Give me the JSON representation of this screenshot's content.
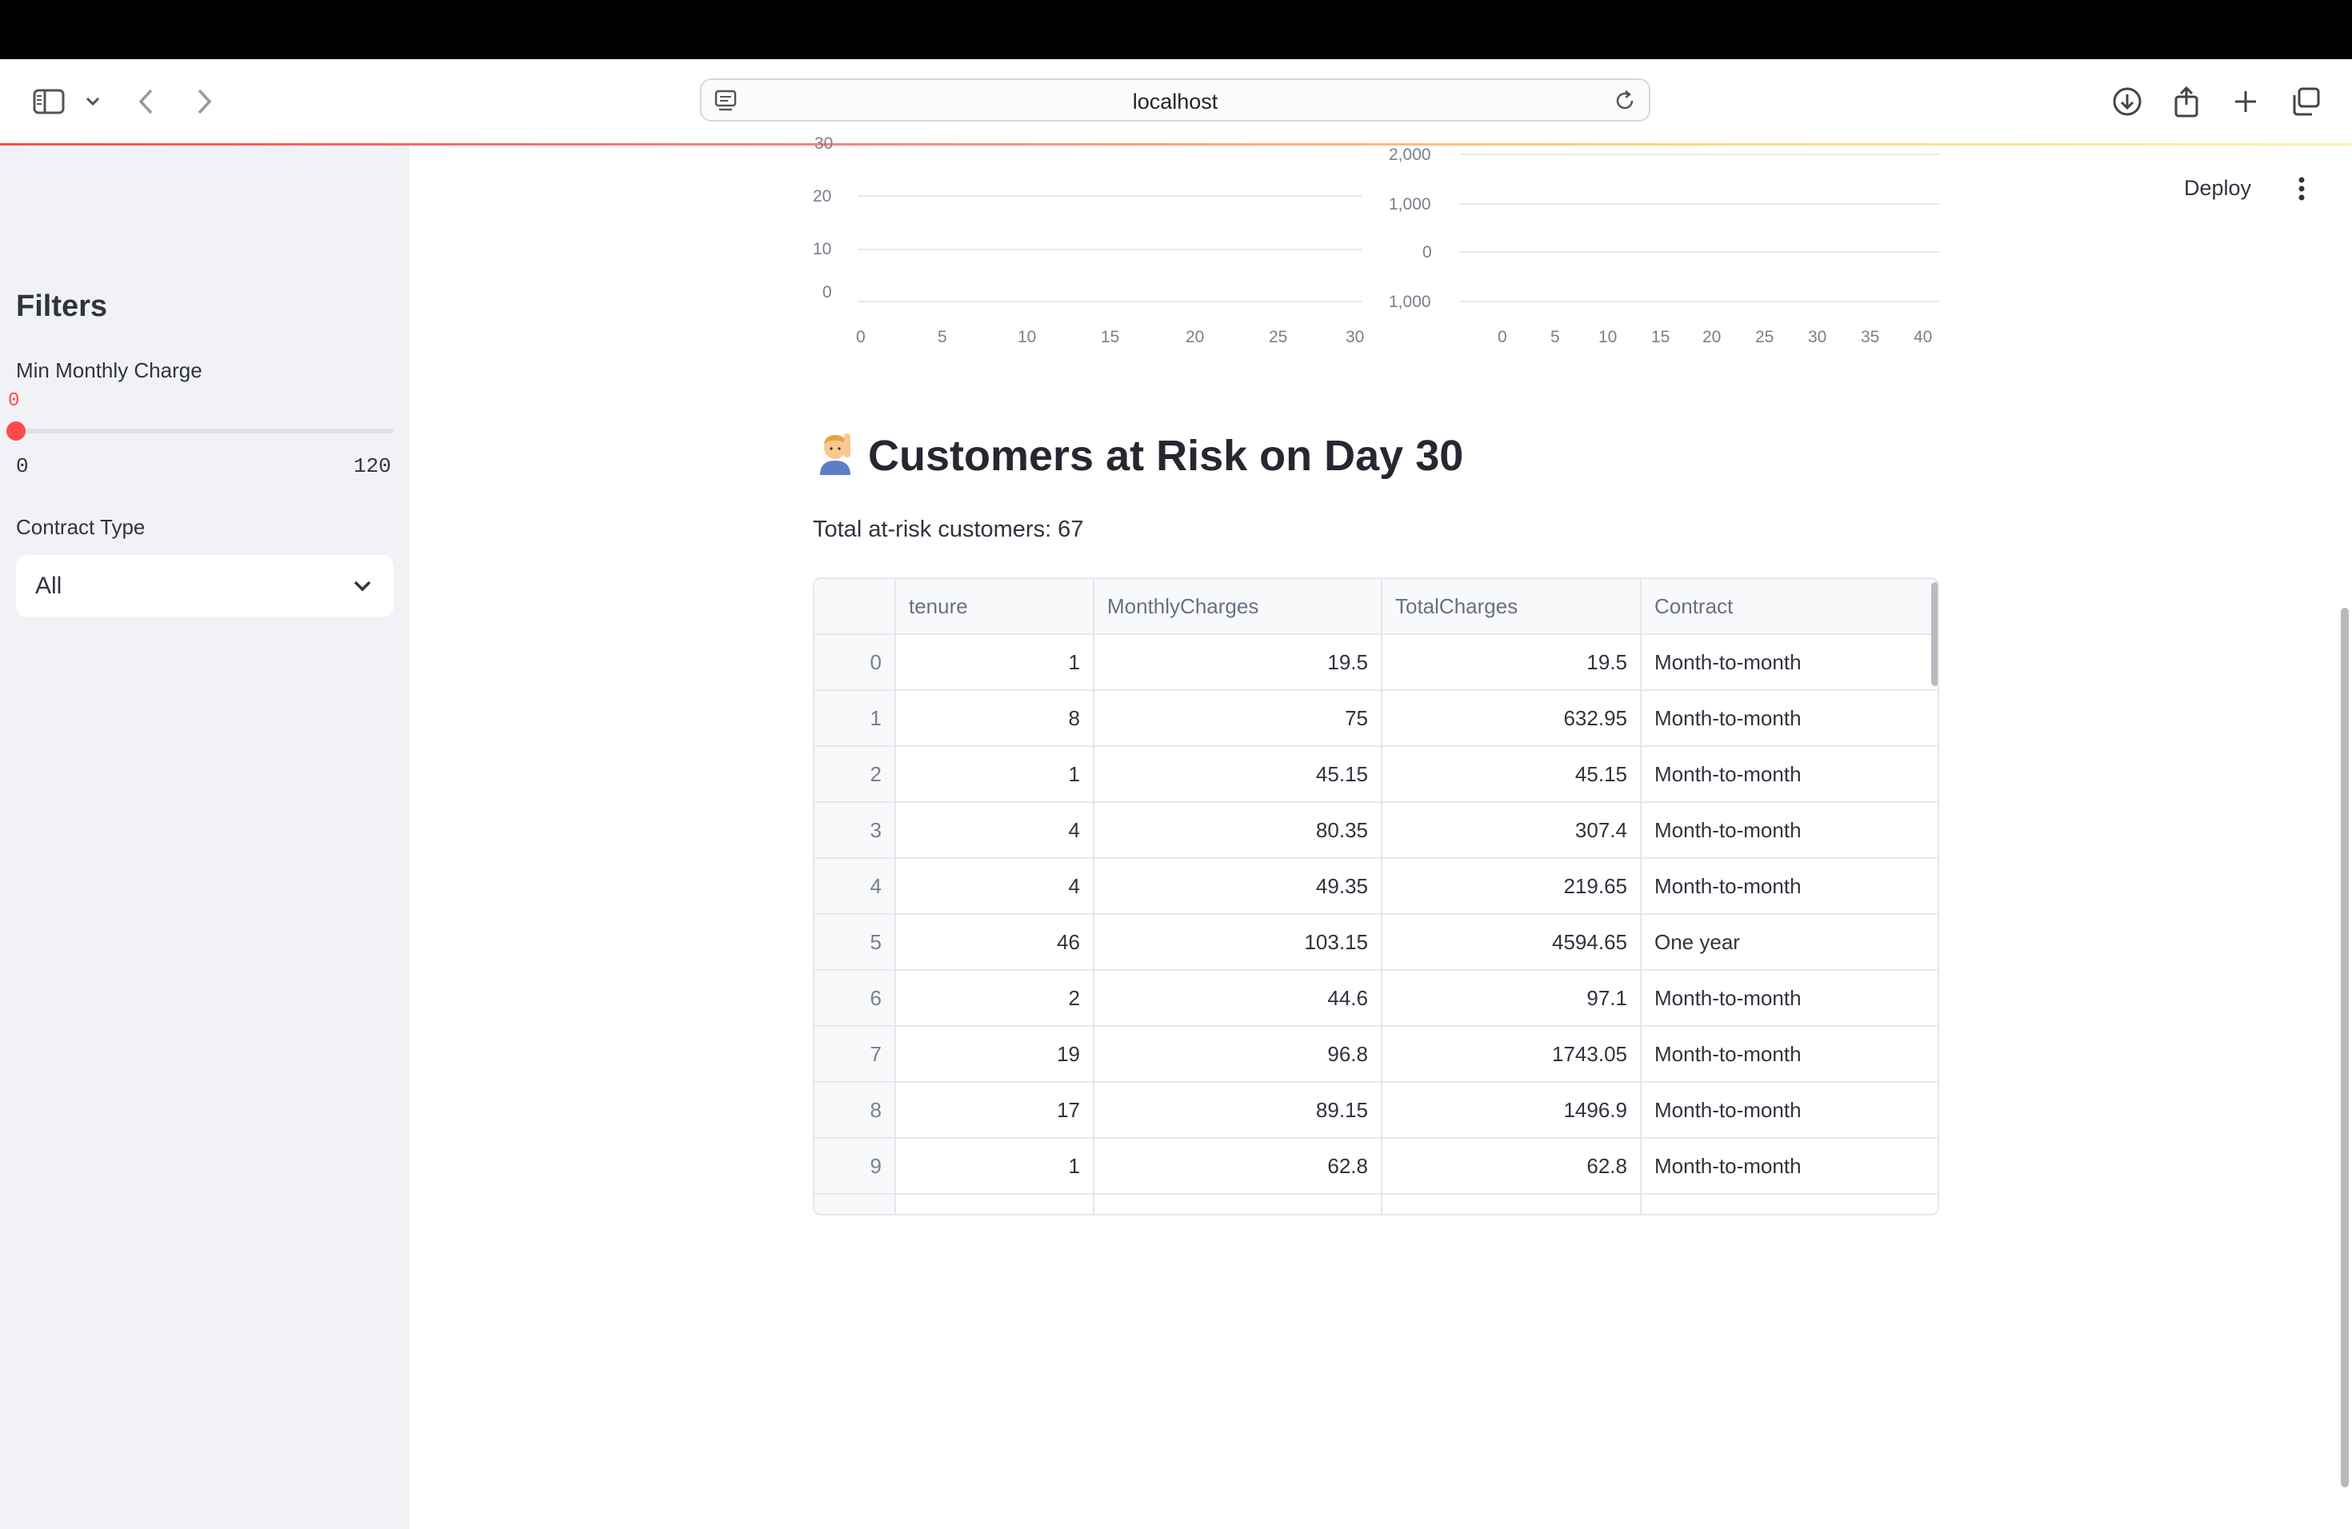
{
  "browser": {
    "url": "localhost"
  },
  "sidebar": {
    "title": "Filters",
    "min_charge": {
      "label": "Min Monthly Charge",
      "value": "0",
      "min": "0",
      "max": "120",
      "fraction": 0
    },
    "contract": {
      "label": "Contract Type",
      "selected": "All"
    }
  },
  "header": {
    "deploy_label": "Deploy"
  },
  "charts": {
    "left": {
      "y_ticks": [
        "30",
        "20",
        "10",
        "0"
      ],
      "x_ticks": [
        "0",
        "5",
        "10",
        "15",
        "20",
        "25",
        "30"
      ]
    },
    "right": {
      "y_ticks": [
        "2,000",
        "1,000",
        "0",
        "1,000"
      ],
      "x_ticks": [
        "0",
        "5",
        "10",
        "15",
        "20",
        "25",
        "30",
        "35",
        "40"
      ]
    }
  },
  "main": {
    "heading": "Customers at Risk on Day 30",
    "heading_emoji": "person-raising-hand",
    "subtext": "Total at-risk customers: 67"
  },
  "table": {
    "columns": [
      "",
      "tenure",
      "MonthlyCharges",
      "TotalCharges",
      "Contract"
    ],
    "rows": [
      [
        "0",
        "1",
        "19.5",
        "19.5",
        "Month-to-month"
      ],
      [
        "1",
        "8",
        "75",
        "632.95",
        "Month-to-month"
      ],
      [
        "2",
        "1",
        "45.15",
        "45.15",
        "Month-to-month"
      ],
      [
        "3",
        "4",
        "80.35",
        "307.4",
        "Month-to-month"
      ],
      [
        "4",
        "4",
        "49.35",
        "219.65",
        "Month-to-month"
      ],
      [
        "5",
        "46",
        "103.15",
        "4594.65",
        "One year"
      ],
      [
        "6",
        "2",
        "44.6",
        "97.1",
        "Month-to-month"
      ],
      [
        "7",
        "19",
        "96.8",
        "1743.05",
        "Month-to-month"
      ],
      [
        "8",
        "17",
        "89.15",
        "1496.9",
        "Month-to-month"
      ],
      [
        "9",
        "1",
        "62.8",
        "62.8",
        "Month-to-month"
      ]
    ]
  }
}
